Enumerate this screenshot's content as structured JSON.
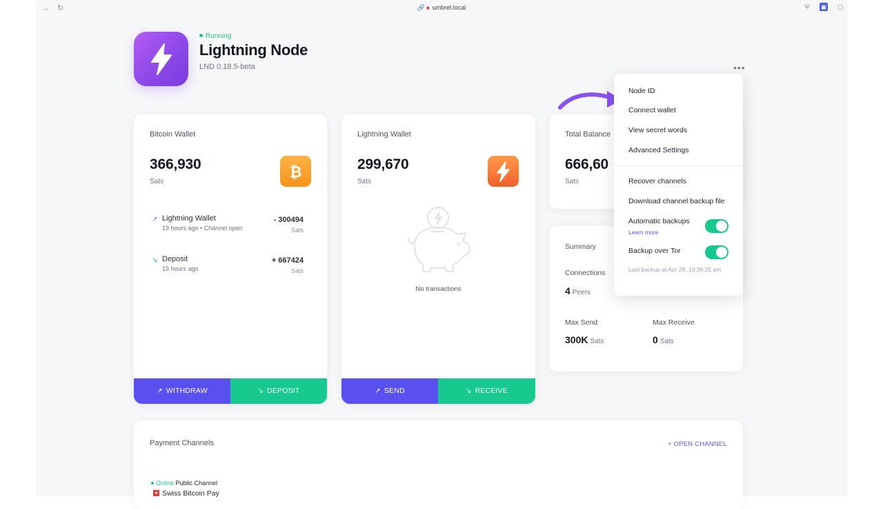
{
  "browser": {
    "url": "umbrel.local"
  },
  "app": {
    "status": "Running",
    "title": "Lightning Node",
    "version": "LND 0.18.5-beta"
  },
  "bitcoin_wallet": {
    "label": "Bitcoin Wallet",
    "balance": "366,930",
    "unit": "Sats",
    "transactions": [
      {
        "direction": "out",
        "title": "Lightning Wallet",
        "meta": "19 hours ago • Channel open",
        "amount": "- 300494",
        "unit": "Sats"
      },
      {
        "direction": "in",
        "title": "Deposit",
        "meta": "19 hours ago",
        "amount": "+ 667424",
        "unit": "Sats"
      }
    ],
    "withdraw_label": "WITHDRAW",
    "deposit_label": "DEPOSIT"
  },
  "lightning_wallet": {
    "label": "Lightning Wallet",
    "balance": "299,670",
    "unit": "Sats",
    "empty_text": "No transactions",
    "send_label": "SEND",
    "receive_label": "RECEIVE"
  },
  "total_balance": {
    "label": "Total Balance",
    "balance": "666,60",
    "unit": "Sats"
  },
  "summary": {
    "label": "Summary",
    "connections_label": "Connections",
    "connections_value": "4",
    "connections_unit": "Peers",
    "max_send_label": "Max Send",
    "max_send_value": "300K",
    "max_send_unit": "Sats",
    "max_receive_label": "Max Receive",
    "max_receive_value": "0",
    "max_receive_unit": "Sats"
  },
  "menu": {
    "node_id": "Node ID",
    "connect_wallet": "Connect wallet",
    "view_secret_words": "View secret words",
    "advanced_settings": "Advanced Settings",
    "recover_channels": "Recover channels",
    "download_backup": "Download channel backup file",
    "automatic_backups": "Automatic backups",
    "learn_more": "Learn more",
    "backup_over_tor": "Backup over Tor",
    "last_backup": "Last backup at Apr 28, 10:36:25 am",
    "automatic_backups_on": true,
    "backup_over_tor_on": true
  },
  "payment_channels": {
    "label": "Payment Channels",
    "open_channel": "+ OPEN CHANNEL",
    "channel_status": "Online",
    "channel_type": "Public Channel",
    "channel_name": "Swiss Bitcoin Pay"
  },
  "colors": {
    "accent_purple": "#5a50f0",
    "accent_green": "#17c98e",
    "app_icon": "#9b50ee",
    "bitcoin_orange": "#f7931a",
    "status_green": "#1fbf8f"
  },
  "icons": {
    "app": "lightning-bolt-icon",
    "bitcoin": "bitcoin-icon",
    "lightning": "lightning-bolt-icon",
    "empty_state": "piggy-bank-icon",
    "annotation": "curved-arrow-icon"
  }
}
